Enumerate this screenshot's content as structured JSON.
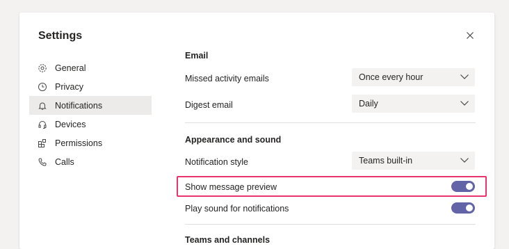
{
  "dialog": {
    "title": "Settings"
  },
  "nav": {
    "items": [
      {
        "label": "General",
        "icon": "gear-icon"
      },
      {
        "label": "Privacy",
        "icon": "clock-icon"
      },
      {
        "label": "Notifications",
        "icon": "bell-icon",
        "active": true
      },
      {
        "label": "Devices",
        "icon": "headset-icon"
      },
      {
        "label": "Permissions",
        "icon": "apps-icon"
      },
      {
        "label": "Calls",
        "icon": "phone-icon"
      }
    ]
  },
  "email": {
    "title": "Email",
    "missed_label": "Missed activity emails",
    "missed_value": "Once every hour",
    "digest_label": "Digest email",
    "digest_value": "Daily"
  },
  "appearance": {
    "title": "Appearance and sound",
    "style_label": "Notification style",
    "style_value": "Teams built-in",
    "preview_label": "Show message preview",
    "preview_on": true,
    "sound_label": "Play sound for notifications",
    "sound_on": true
  },
  "teams": {
    "title": "Teams and channels"
  },
  "colors": {
    "accent": "#6264a7",
    "highlight": "#e8336d"
  }
}
